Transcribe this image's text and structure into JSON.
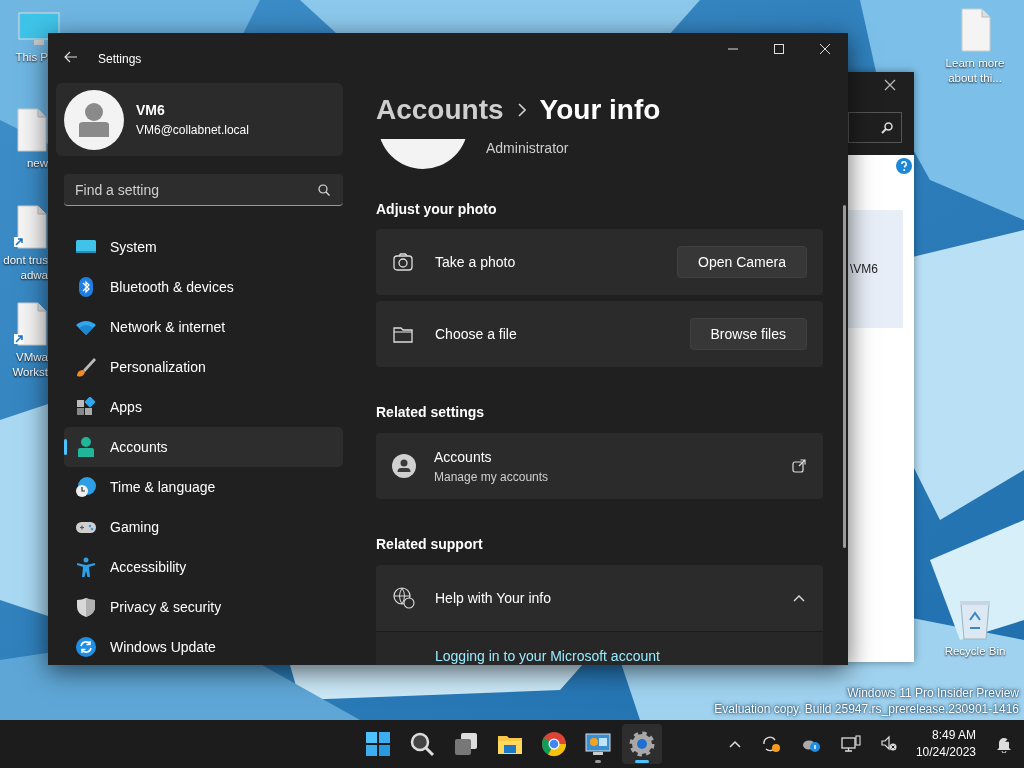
{
  "desktop": {
    "left_icons": [
      {
        "kind": "pc",
        "lines": [
          "This P"
        ]
      },
      {
        "kind": "file",
        "lines": [
          "new"
        ]
      },
      {
        "kind": "shortcut",
        "lines": [
          "dont trus",
          "adwa"
        ]
      },
      {
        "kind": "shortcut",
        "lines": [
          "VMwa",
          "Workst"
        ]
      }
    ],
    "right_icons": [
      {
        "kind": "file",
        "lines": [
          "Learn more",
          "about thi..."
        ]
      },
      {
        "kind": "recycle",
        "lines": [
          "Recycle Bin"
        ]
      }
    ],
    "watermark": [
      "Windows 11 Pro Insider Preview",
      "Evaluation copy. Build 25947.rs_prerelease.230901-1416"
    ]
  },
  "background_window": {
    "text": "\\VM6"
  },
  "settings": {
    "title": "Settings",
    "user": {
      "name": "VM6",
      "email": "VM6@collabnet.local"
    },
    "search": {
      "placeholder": "Find a setting"
    },
    "nav": [
      {
        "kind": "system",
        "label": "System",
        "selected": false
      },
      {
        "kind": "bluetooth",
        "label": "Bluetooth & devices",
        "selected": false
      },
      {
        "kind": "network",
        "label": "Network & internet",
        "selected": false
      },
      {
        "kind": "brush",
        "label": "Personalization",
        "selected": false
      },
      {
        "kind": "apps",
        "label": "Apps",
        "selected": false
      },
      {
        "kind": "accounts",
        "label": "Accounts",
        "selected": true
      },
      {
        "kind": "time",
        "label": "Time & language",
        "selected": false
      },
      {
        "kind": "gaming",
        "label": "Gaming",
        "selected": false
      },
      {
        "kind": "accessibility",
        "label": "Accessibility",
        "selected": false
      },
      {
        "kind": "privacy",
        "label": "Privacy & security",
        "selected": false
      },
      {
        "kind": "update",
        "label": "Windows Update",
        "selected": false
      }
    ],
    "breadcrumb": [
      "Accounts",
      "Your info"
    ],
    "role": "Administrator",
    "photo_heading": "Adjust your photo",
    "photo_options": [
      {
        "kind": "camera",
        "label": "Take a photo",
        "button": "Open Camera"
      },
      {
        "kind": "folder",
        "label": "Choose a file",
        "button": "Browse files"
      }
    ],
    "related_heading": "Related settings",
    "related": {
      "title": "Accounts",
      "subtitle": "Manage my accounts"
    },
    "support_heading": "Related support",
    "support": {
      "title": "Help with Your info",
      "expanded": true,
      "link": "Logging in to your Microsoft account"
    }
  },
  "taskbar": {
    "apps": [
      {
        "kind": "start",
        "running": false,
        "selected": false
      },
      {
        "kind": "search",
        "running": false,
        "selected": false
      },
      {
        "kind": "taskview",
        "running": false,
        "selected": false
      },
      {
        "kind": "explorer",
        "running": false,
        "selected": false
      },
      {
        "kind": "chrome",
        "running": false,
        "selected": false
      },
      {
        "kind": "vmware",
        "running": true,
        "selected": false
      },
      {
        "kind": "settings",
        "running": true,
        "selected": true
      }
    ],
    "time": "8:49 AM",
    "date": "10/24/2023"
  }
}
